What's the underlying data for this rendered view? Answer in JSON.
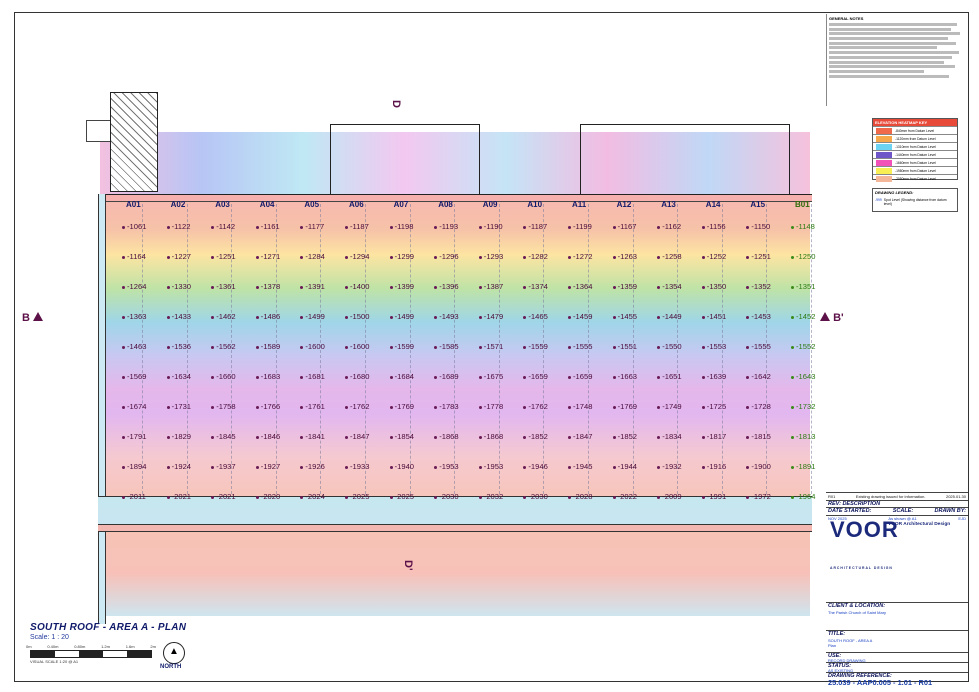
{
  "plan": {
    "title": "SOUTH ROOF - AREA A - PLAN",
    "scale": "Scale: 1 : 20",
    "north_label": "NORTH",
    "scale_ticks": [
      "0m",
      "0.40m",
      "0.80m",
      "1.2m",
      "1.6m",
      "2m"
    ],
    "scale_note": "VISUAL SCALE 1:20 @ A1"
  },
  "section_marks": {
    "b_left": "B",
    "b_right": "B'",
    "d_top": "D",
    "d_bottom": "D'"
  },
  "columns": [
    {
      "id": "A01",
      "values": [
        "-1061",
        "-1164",
        "-1264",
        "-1363",
        "-1463",
        "-1569",
        "-1674",
        "-1791",
        "-1894",
        "-2011"
      ]
    },
    {
      "id": "A02",
      "values": [
        "-1122",
        "-1227",
        "-1330",
        "-1433",
        "-1536",
        "-1634",
        "-1731",
        "-1829",
        "-1924",
        "-2021"
      ]
    },
    {
      "id": "A03",
      "values": [
        "-1142",
        "-1251",
        "-1361",
        "-1462",
        "-1562",
        "-1660",
        "-1758",
        "-1845",
        "-1937",
        "-2021"
      ]
    },
    {
      "id": "A04",
      "values": [
        "-1161",
        "-1271",
        "-1378",
        "-1486",
        "-1589",
        "-1683",
        "-1766",
        "-1846",
        "-1927",
        "-2020"
      ]
    },
    {
      "id": "A05",
      "values": [
        "-1177",
        "-1284",
        "-1391",
        "-1499",
        "-1600",
        "-1681",
        "-1761",
        "-1841",
        "-1926",
        "-2024"
      ]
    },
    {
      "id": "A06",
      "values": [
        "-1187",
        "-1294",
        "-1400",
        "-1500",
        "-1600",
        "-1680",
        "-1762",
        "-1847",
        "-1933",
        "-2025"
      ]
    },
    {
      "id": "A07",
      "values": [
        "-1198",
        "-1299",
        "-1399",
        "-1499",
        "-1599",
        "-1684",
        "-1769",
        "-1854",
        "-1940",
        "-2025"
      ]
    },
    {
      "id": "A08",
      "values": [
        "-1193",
        "-1296",
        "-1396",
        "-1493",
        "-1585",
        "-1689",
        "-1783",
        "-1868",
        "-1953",
        "-2030"
      ]
    },
    {
      "id": "A09",
      "values": [
        "-1190",
        "-1293",
        "-1387",
        "-1479",
        "-1571",
        "-1675",
        "-1778",
        "-1868",
        "-1953",
        "-2032"
      ]
    },
    {
      "id": "A10",
      "values": [
        "-1187",
        "-1282",
        "-1374",
        "-1465",
        "-1559",
        "-1659",
        "-1762",
        "-1852",
        "-1946",
        "-2030"
      ]
    },
    {
      "id": "A11",
      "values": [
        "-1199",
        "-1272",
        "-1364",
        "-1459",
        "-1555",
        "-1659",
        "-1748",
        "-1847",
        "-1945",
        "-2028"
      ]
    },
    {
      "id": "A12",
      "values": [
        "-1167",
        "-1263",
        "-1359",
        "-1455",
        "-1551",
        "-1663",
        "-1769",
        "-1852",
        "-1944",
        "-2022"
      ]
    },
    {
      "id": "A13",
      "values": [
        "-1162",
        "-1258",
        "-1354",
        "-1449",
        "-1550",
        "-1651",
        "-1749",
        "-1834",
        "-1932",
        "-2009"
      ]
    },
    {
      "id": "A14",
      "values": [
        "-1156",
        "-1252",
        "-1350",
        "-1451",
        "-1553",
        "-1639",
        "-1725",
        "-1817",
        "-1916",
        "-1991"
      ]
    },
    {
      "id": "A15",
      "values": [
        "-1150",
        "-1251",
        "-1352",
        "-1453",
        "-1555",
        "-1642",
        "-1728",
        "-1815",
        "-1900",
        "-1972"
      ]
    },
    {
      "id": "B01",
      "values": [
        "-1148",
        "-1250",
        "-1351",
        "-1452",
        "-1552",
        "-1643",
        "-1732",
        "-1813",
        "-1891",
        "-1964"
      ],
      "green": true
    }
  ],
  "notes": {
    "header": "GENERAL NOTES"
  },
  "heatmap_key": {
    "title": "ELEVATION HEATMAP KEY",
    "rows": [
      {
        "color": "#f0694a",
        "label": "-840mm from Datum Level"
      },
      {
        "color": "#f7a84b",
        "label": "-1120mm from Datum Level"
      },
      {
        "color": "#6dd3f2",
        "label": "-1310mm from Datum Level"
      },
      {
        "color": "#6f56c8",
        "label": "-1440mm from Datum Level"
      },
      {
        "color": "#f252b8",
        "label": "-1660mm from Datum Level"
      },
      {
        "color": "#f7ef53",
        "label": "-1980mm from Datum Level"
      },
      {
        "color": "#f5b79a",
        "label": "-2050mm from Datum Level"
      }
    ]
  },
  "drawing_legend": {
    "title": "DRAWING LEGEND:",
    "item": "Spot Level (Showing distance from datum level)",
    "sample": "-999"
  },
  "title_block": {
    "rev_row": {
      "rev": "R01",
      "desc": "Existing drawing issued for information.",
      "date": "2025.01.30"
    },
    "rev_header": "REV: DESCRIPTION",
    "date_started_label": "DATE STARTED:",
    "scale_label": "SCALE:",
    "drawn_by_label": "DRAWN BY:",
    "date_started": "NOV 2025",
    "scale": "As shown @ A1",
    "drawn_by": "EJD",
    "logo": "VOOR",
    "logo_sub": "ARCHITECTURAL DESIGN",
    "firm_name": "VOOR Architectural Design",
    "client_label": "CLIENT & LOCATION:",
    "client": "The Parish Church of Saint Mary",
    "title_label": "TITLE:",
    "title": "SOUTH ROOF - AREA A",
    "title_sub": "Plan",
    "use_label": "USE:",
    "use": "RECORD DRAWING",
    "status_label": "STATUS:",
    "status": "AS EXISTING",
    "ref_label": "DRAWING REFERENCE:",
    "ref": "25.039 - AAP0.005 - 1.01 - R01"
  }
}
